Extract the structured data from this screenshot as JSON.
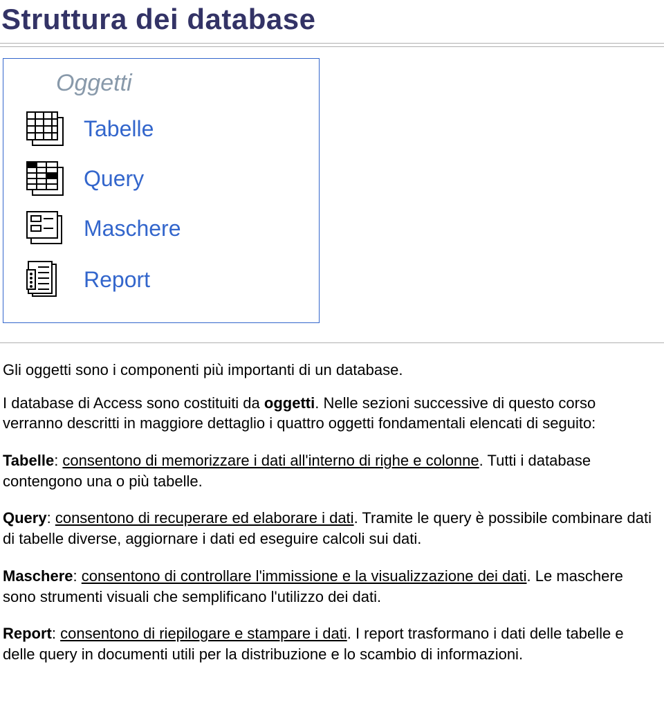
{
  "title": "Struttura dei database",
  "panel": {
    "heading": "Oggetti",
    "items": [
      {
        "label": "Tabelle"
      },
      {
        "label": "Query"
      },
      {
        "label": "Maschere"
      },
      {
        "label": "Report"
      }
    ]
  },
  "intro": {
    "line1": "Gli oggetti sono i componenti più importanti di un database.",
    "line2_pre": "I database di Access sono costituiti da ",
    "line2_bold": "oggetti",
    "line2_post": ". Nelle sezioni successive di questo corso verranno descritti in maggiore dettaglio i quattro oggetti fondamentali elencati di seguito:"
  },
  "sections": {
    "tabelle": {
      "name": "Tabelle",
      "underlined": "consentono di memorizzare i dati all'interno di righe e colonne",
      "rest": ". Tutti i database contengono una o più tabelle."
    },
    "query": {
      "name": "Query",
      "underlined": "consentono di recuperare ed elaborare i dati",
      "rest": ". Tramite le query è possibile combinare dati di tabelle diverse, aggiornare i dati ed eseguire calcoli sui dati."
    },
    "maschere": {
      "name": "Maschere",
      "underlined": "consentono di controllare l'immissione e la visualizzazione dei dati",
      "rest": ". Le maschere sono strumenti visuali che semplificano l'utilizzo dei dati."
    },
    "report": {
      "name": "Report",
      "underlined": "consentono di riepilogare e stampare i dati",
      "rest": ". I report trasformano i dati delle tabelle e delle query in documenti utili per la distribuzione e lo scambio di informazioni."
    }
  }
}
